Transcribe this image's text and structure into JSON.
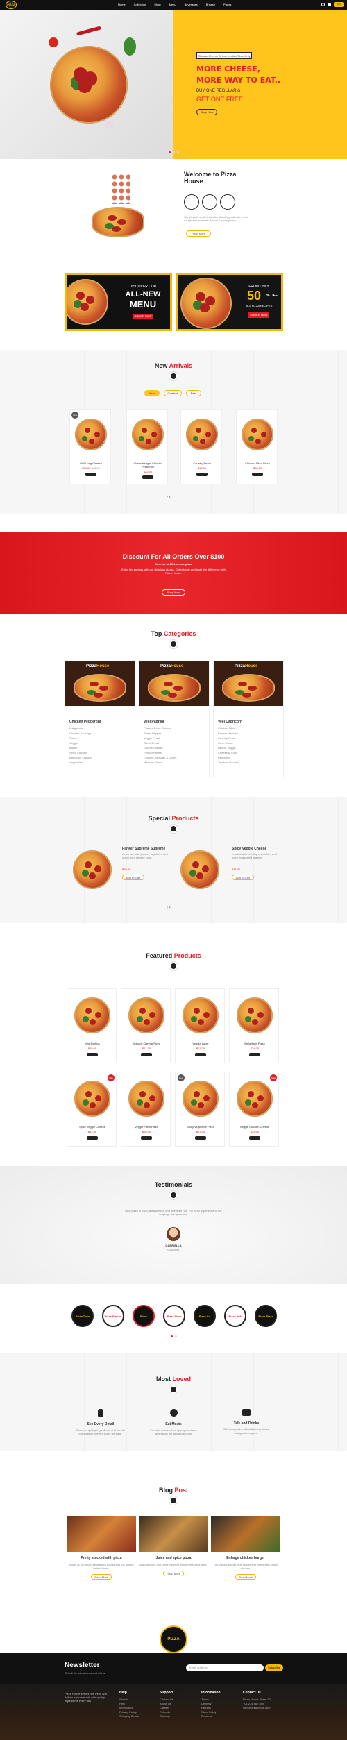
{
  "nav": {
    "logo_text": "PIZZA",
    "items": [
      "Home",
      "Collection",
      "Shop",
      "Menu",
      "Beverages",
      "Browse",
      "Pages"
    ],
    "cart_label": "Cart"
  },
  "hero": {
    "badge": "Choose Cheesy Bytes - Limited Time Only",
    "line1": "MORE CHEESE,",
    "line2": "MORE WAY TO EAT..",
    "line3": "BUY ONE REGULAR &",
    "line4": "GET ONE FREE",
    "cta": "Shop Now"
  },
  "welcome": {
    "title": "Welcome to Pizza House",
    "text": "Our pizza is crafted with the finest ingredients, fresh dough and authentic flavors for every slice.",
    "cta": "Read More",
    "icons": [
      "pizza-slice-icon",
      "cheese-icon",
      "oven-icon"
    ]
  },
  "promo": {
    "left_small": "DISCOVER OUR",
    "left_big1": "ALL-NEW",
    "left_big2": "MENU",
    "left_cta": "ORDER NOW",
    "right_small": "FROM ONLY",
    "right_pct": "50",
    "right_off": "% OFF",
    "right_sub": "ALL PIZZA RECIPES",
    "right_cta": "ORDER NOW"
  },
  "arrivals": {
    "title_a": "New",
    "title_b": "Arrivals",
    "tabs": [
      "Pizza",
      "Combos",
      "Beer"
    ],
    "products": [
      {
        "name": "Grill Long Cheese",
        "price": "$39.00",
        "old": "$45.00",
        "badge": "New"
      },
      {
        "name": "Cheeseburger Chicken Pepperoni",
        "price": "$22.00",
        "old": "",
        "badge": ""
      },
      {
        "name": "Country Feast",
        "price": "$19.00",
        "old": "",
        "badge": ""
      },
      {
        "name": "Chicken Tikka Pizza",
        "price": "$28.00",
        "old": "",
        "badge": ""
      }
    ]
  },
  "discount": {
    "title": "Discount For All Orders Over $100",
    "sub": "Save up to 10% on our pizza",
    "text": "Enjoy big savings with our delicious pizzas. Order today and taste the difference with Pizza House.",
    "cta": "Shop Now"
  },
  "categories": {
    "title_a": "Top",
    "title_b": "Categories",
    "brand_a": "Pizza",
    "brand_b": "House",
    "cols": [
      {
        "name": "Chicken Pepperoni",
        "items": [
          "Margherita",
          "Chicken Sausage",
          "Paneer",
          "Veggie",
          "Bacon",
          "Spicy Chicken",
          "Barbeque Chicken",
          "Vegetarian"
        ]
      },
      {
        "name": "Veel Paprika",
        "items": [
          "Cheese Burst Chicken",
          "Sweet Pepper",
          "Veggie Feast",
          "Garlic Bread",
          "Double Cheese",
          "Pepper Paneer",
          "Chicken Sausage & Olives",
          "Mexican Green"
        ]
      },
      {
        "name": "Veel Capricorn",
        "items": [
          "Chicken Tikka",
          "Paneer Makhani",
          "Country Feast",
          "Farm House",
          "Deluxe Veggie",
          "Cheese & Corn",
          "Pepperoni",
          "Tandoori Paneer"
        ]
      }
    ]
  },
  "special": {
    "title_a": "Special",
    "title_b": "Products",
    "items": [
      {
        "name": "Paneer Supreme Supreme",
        "price": "$29.00",
        "text": "A rich blend of paneer, capsicum and onion on a cheesy crust."
      },
      {
        "name": "Spicy Veggie Cheese",
        "price": "$31.00",
        "text": "Loaded with crunchy vegetables and extra mozzarella cheese."
      }
    ],
    "cta": "Add to Cart"
  },
  "featured": {
    "title_a": "Featured",
    "title_b": "Products",
    "products": [
      {
        "name": "Veg Exotica",
        "price": "$18.00",
        "badge": ""
      },
      {
        "name": "Spinach Cheese Pizza",
        "price": "$21.00",
        "badge": ""
      },
      {
        "name": "Veggie Lover",
        "price": "$17.00",
        "badge": ""
      },
      {
        "name": "Bella Italia Pizza",
        "price": "$24.00",
        "badge": ""
      },
      {
        "name": "Spicy Veggie Cheese",
        "price": "$31.00",
        "badge": "Sale"
      },
      {
        "name": "Veggie Farm Pizza",
        "price": "$20.00",
        "badge": ""
      },
      {
        "name": "Spicy Vegetable Pizza",
        "price": "$27.00",
        "badge": "New"
      },
      {
        "name": "Veggie Chicken Cheese",
        "price": "$25.00",
        "badge": "Sale"
      }
    ]
  },
  "testimonials": {
    "title": "Testimonials",
    "quote": "Best pizza in town, always fresh and delivered hot. The crust is perfect and the toppings are generous.",
    "author": "GABRIELLA",
    "role": "Customer"
  },
  "brands": [
    "Pizza Time",
    "Pizza Station",
    "Pizza",
    "Pizza Shop",
    "Pizza Co",
    "Pizza Hub",
    "Pizza Place"
  ],
  "loved": {
    "title_a": "Most",
    "title_b": "Loved",
    "items": [
      {
        "name": "See Every Detail",
        "icon": "fire-hydrant-icon",
        "text": "Discover quality ingredients and careful preparation in every pizza we bake."
      },
      {
        "name": "Eat Meats",
        "icon": "film-camera-icon",
        "text": "Premium meats, freshly prepared and layered on our signature crust."
      },
      {
        "name": "Talk and Drinks",
        "icon": "speech-cup-icon",
        "text": "Pair your pizza with refreshing drinks and great company."
      }
    ]
  },
  "blog": {
    "title_a": "Blog",
    "title_b": "Post",
    "posts": [
      {
        "title": "Pretty stacked with pizza",
        "text": "A look at our favourite stacked pizzas and the stories behind them.",
        "cta": "Read More"
      },
      {
        "title": "Juice and spice pizza",
        "text": "Bold flavours that bring the heat with a refreshing twist.",
        "cta": "Read More"
      },
      {
        "title": "Enlarge chicken burger",
        "text": "Our classic burger gets bigger and better with crispy chicken.",
        "cta": "Read More"
      }
    ]
  },
  "newsletter": {
    "title": "Newsletter",
    "sub": "Get all the latest news and offers.",
    "placeholder": "Email Address",
    "cta": "Subscribe"
  },
  "footer": {
    "about": "Pizza House serves hot, fresh and delicious pizza made with quality ingredients every day.",
    "cols": [
      {
        "title": "Help",
        "links": [
          "Search",
          "Help",
          "Information",
          "Privacy Policy",
          "Shipping Details"
        ]
      },
      {
        "title": "Support",
        "links": [
          "Contact Us",
          "About Us",
          "Careers",
          "Refunds",
          "Sitemap"
        ]
      },
      {
        "title": "Information",
        "links": [
          "Terms",
          "Delivery",
          "Returns",
          "Store Policy",
          "Reviews"
        ]
      },
      {
        "title": "Contact us",
        "links": [
          "Pizza House Street 12",
          "+01 234 567 890",
          "info@pizzahouse.com"
        ]
      }
    ]
  },
  "colors": {
    "accent": "#e31c23",
    "yellow": "#ffc51c",
    "dark": "#111111"
  }
}
